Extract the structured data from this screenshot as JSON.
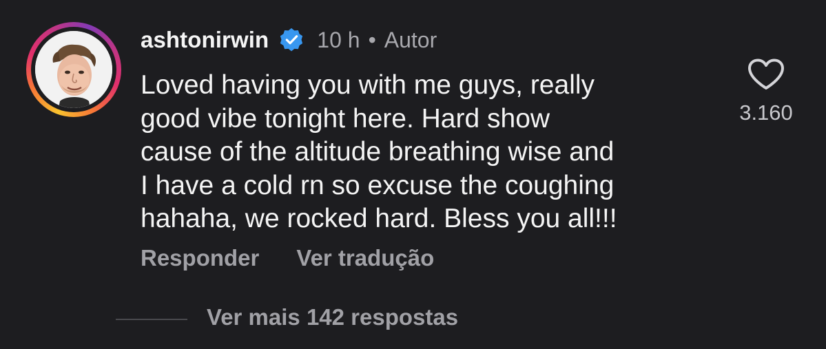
{
  "comment": {
    "username": "ashtonirwin",
    "verified_icon": "verified-badge-icon",
    "time": "10 h",
    "separator": "•",
    "role": "Autor",
    "text_lines": [
      "Loved having you with me guys, really",
      "good vibe tonight here. Hard show",
      "cause of the altitude breathing wise and",
      "I have a cold rn so excuse the coughing",
      "hahaha, we rocked hard. Bless you all!!!"
    ],
    "actions": {
      "reply": "Responder",
      "translate": "Ver tradução"
    },
    "like": {
      "icon": "heart-icon",
      "count": "3.160"
    },
    "replies": {
      "label": "Ver mais 142 respostas"
    }
  },
  "colors": {
    "background": "#1d1d20",
    "verified_blue": "#3897f0",
    "secondary_text": "#a1a1a6"
  }
}
